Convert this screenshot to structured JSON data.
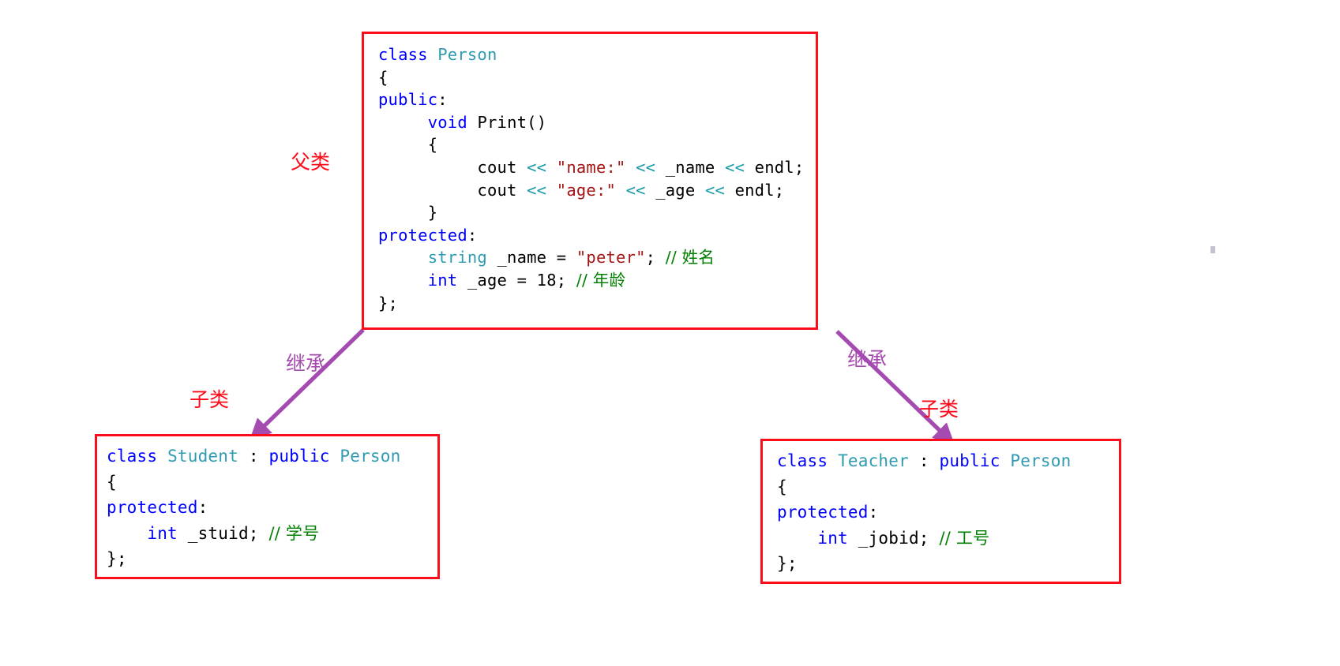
{
  "diagram": {
    "title": "C++ inheritance diagram: Person base class with Student and Teacher derived classes",
    "colors": {
      "box_border": "#fc0d1b",
      "arrow": "#a44ab0",
      "label_red": "#fb0a18",
      "label_purple": "#a44ab0",
      "keyword": "#0000ff",
      "typename": "#2e9bb0",
      "string": "#a31515",
      "comment": "#008000",
      "operator": "#1a9aa8",
      "background": "#ffffff"
    }
  },
  "parent_box": {
    "name": "Person",
    "lines": [
      [
        {
          "t": "class ",
          "c": "kw"
        },
        {
          "t": "Person",
          "c": "type"
        }
      ],
      [
        {
          "t": "{",
          "c": "pl"
        }
      ],
      [
        {
          "t": "public",
          "c": "kw"
        },
        {
          "t": ":",
          "c": "pl"
        }
      ],
      [
        {
          "t": "     ",
          "c": "pl"
        },
        {
          "t": "void ",
          "c": "kw"
        },
        {
          "t": "Print()",
          "c": "pl"
        }
      ],
      [
        {
          "t": "     {",
          "c": "pl"
        }
      ],
      [
        {
          "t": "          cout ",
          "c": "pl"
        },
        {
          "t": "<<",
          "c": "op"
        },
        {
          "t": " \"name:\"",
          "c": "str"
        },
        {
          "t": " <<",
          "c": "op"
        },
        {
          "t": " _name ",
          "c": "pl"
        },
        {
          "t": "<<",
          "c": "op"
        },
        {
          "t": " endl;",
          "c": "pl"
        }
      ],
      [
        {
          "t": "          cout ",
          "c": "pl"
        },
        {
          "t": "<<",
          "c": "op"
        },
        {
          "t": " \"age:\"",
          "c": "str"
        },
        {
          "t": " <<",
          "c": "op"
        },
        {
          "t": " _age ",
          "c": "pl"
        },
        {
          "t": "<<",
          "c": "op"
        },
        {
          "t": " endl;",
          "c": "pl"
        }
      ],
      [
        {
          "t": "     }",
          "c": "pl"
        }
      ],
      [
        {
          "t": "protected",
          "c": "kw"
        },
        {
          "t": ":",
          "c": "pl"
        }
      ],
      [
        {
          "t": "     ",
          "c": "pl"
        },
        {
          "t": "string ",
          "c": "type"
        },
        {
          "t": "_name = ",
          "c": "pl"
        },
        {
          "t": "\"peter\"",
          "c": "str"
        },
        {
          "t": "; ",
          "c": "pl"
        },
        {
          "t": "// 姓名",
          "c": "cmt"
        }
      ],
      [
        {
          "t": "     ",
          "c": "pl"
        },
        {
          "t": "int ",
          "c": "kw"
        },
        {
          "t": "_age = 18; ",
          "c": "pl"
        },
        {
          "t": "// 年龄",
          "c": "cmt"
        }
      ],
      [
        {
          "t": "};",
          "c": "pl"
        }
      ]
    ]
  },
  "student_box": {
    "name": "Student",
    "lines": [
      [
        {
          "t": "class ",
          "c": "kw"
        },
        {
          "t": "Student ",
          "c": "type"
        },
        {
          "t": ": ",
          "c": "pl"
        },
        {
          "t": "public ",
          "c": "kw"
        },
        {
          "t": "Person",
          "c": "type"
        }
      ],
      [
        {
          "t": "{",
          "c": "pl"
        }
      ],
      [
        {
          "t": "protected",
          "c": "kw"
        },
        {
          "t": ":",
          "c": "pl"
        }
      ],
      [
        {
          "t": "    ",
          "c": "pl"
        },
        {
          "t": "int ",
          "c": "kw"
        },
        {
          "t": "_stuid; ",
          "c": "pl"
        },
        {
          "t": "// 学号",
          "c": "cmt"
        }
      ],
      [
        {
          "t": "};",
          "c": "pl"
        }
      ]
    ]
  },
  "teacher_box": {
    "name": "Teacher",
    "lines": [
      [
        {
          "t": "class ",
          "c": "kw"
        },
        {
          "t": "Teacher ",
          "c": "type"
        },
        {
          "t": ": ",
          "c": "pl"
        },
        {
          "t": "public ",
          "c": "kw"
        },
        {
          "t": "Person",
          "c": "type"
        }
      ],
      [
        {
          "t": "{",
          "c": "pl"
        }
      ],
      [
        {
          "t": "protected",
          "c": "kw"
        },
        {
          "t": ":",
          "c": "pl"
        }
      ],
      [
        {
          "t": "    ",
          "c": "pl"
        },
        {
          "t": "int ",
          "c": "kw"
        },
        {
          "t": "_jobid; ",
          "c": "pl"
        },
        {
          "t": "// 工号",
          "c": "cmt"
        }
      ],
      [
        {
          "t": "};",
          "c": "pl"
        }
      ]
    ]
  },
  "annotations": {
    "parent_label": "父类",
    "child_label_left": "子类",
    "child_label_right": "子类",
    "inherit_label_left": "继承",
    "inherit_label_right": "继承"
  }
}
